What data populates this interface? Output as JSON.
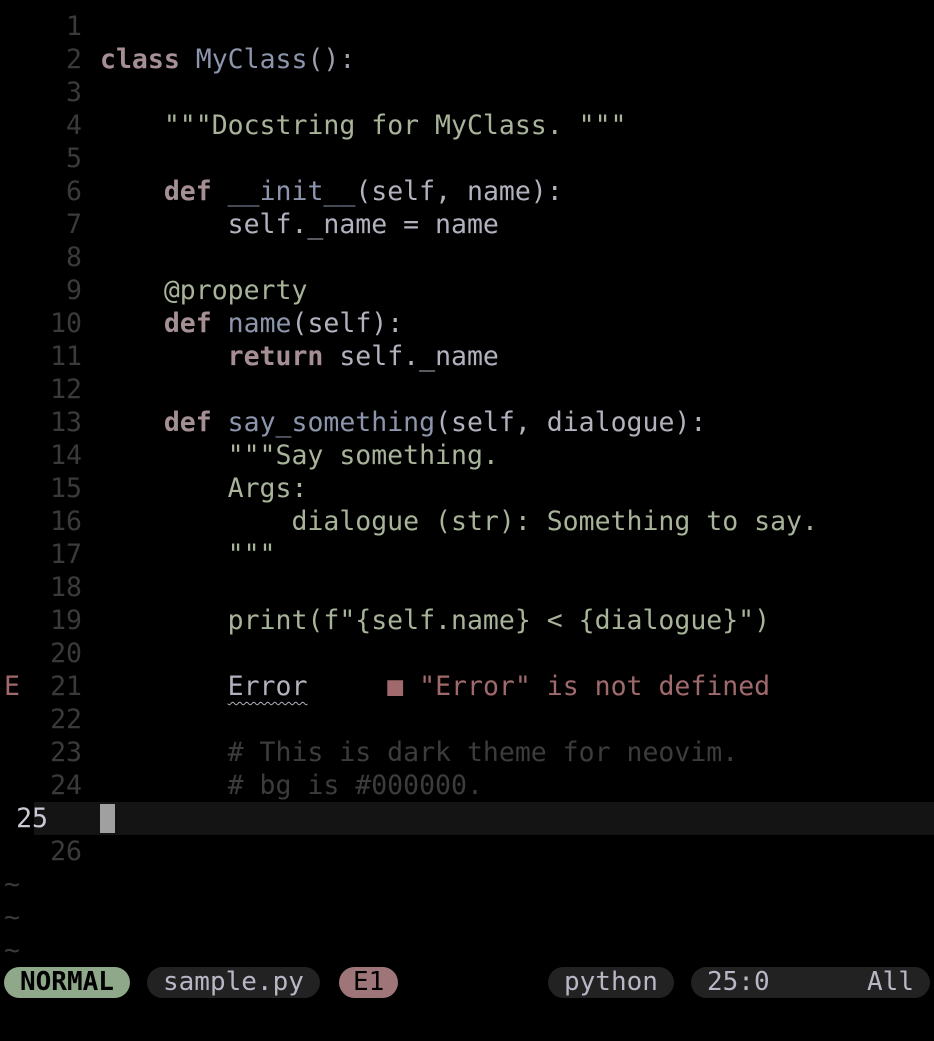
{
  "editor": {
    "lines": [
      {
        "n": "1"
      },
      {
        "n": "2"
      },
      {
        "n": "3"
      },
      {
        "n": "4"
      },
      {
        "n": "5"
      },
      {
        "n": "6"
      },
      {
        "n": "7"
      },
      {
        "n": "8"
      },
      {
        "n": "9"
      },
      {
        "n": "10"
      },
      {
        "n": "11"
      },
      {
        "n": "12"
      },
      {
        "n": "13"
      },
      {
        "n": "14"
      },
      {
        "n": "15"
      },
      {
        "n": "16"
      },
      {
        "n": "17"
      },
      {
        "n": "18"
      },
      {
        "n": "19"
      },
      {
        "n": "20"
      },
      {
        "n": "21"
      },
      {
        "n": "22"
      },
      {
        "n": "23"
      },
      {
        "n": "24"
      },
      {
        "n": "25"
      },
      {
        "n": "26"
      }
    ],
    "tokens": {
      "l2_kw": "class",
      "l2_name": "MyClass",
      "l2_punct": "():",
      "l4_doc": "\"\"\"Docstring for MyClass. \"\"\"",
      "l6_kw": "def",
      "l6_fn": "__init__",
      "l6_args": "(self, name):",
      "l7_code": "self._name = name",
      "l9_dec": "@property",
      "l10_kw": "def",
      "l10_fn": "name",
      "l10_args": "(self):",
      "l11_kw": "return",
      "l11_code": "self._name",
      "l13_kw": "def",
      "l13_fn": "say_something",
      "l13_args": "(self, dialogue):",
      "l14_doc": "\"\"\"Say something.",
      "l15_doc": "Args:",
      "l16_doc": "dialogue (str): Something to say.",
      "l17_doc": "\"\"\"",
      "l19_code": "print(f\"{self.name} < {dialogue}\")",
      "l21_word": "Error",
      "l21_diag_marker": "■",
      "l21_diag": "\"Error\" is not defined",
      "l23_comment": "# This is dark theme for neovim.",
      "l24_comment": "# bg is #000000."
    },
    "sign_error": "E",
    "tilde": "~"
  },
  "statusline": {
    "mode": "NORMAL",
    "filename": "sample.py",
    "diagnostics": "E1",
    "filetype": "python",
    "position": "25:0",
    "scroll": "All"
  },
  "colors": {
    "background": "#000000",
    "keyword": "#a68f94",
    "string": "#a8b49a",
    "error": "#a06a6d",
    "mode_bg": "#8fa88a"
  }
}
